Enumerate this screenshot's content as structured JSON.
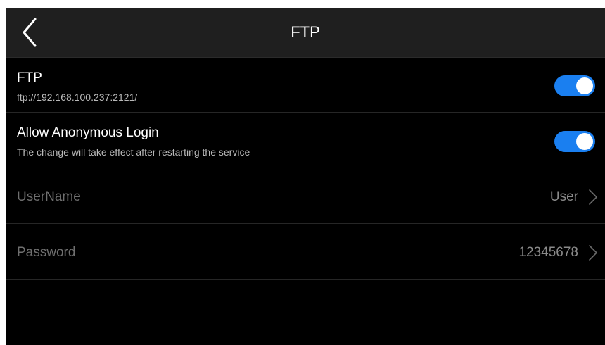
{
  "header": {
    "title": "FTP",
    "back_icon": "chevron-left-icon"
  },
  "ftp": {
    "title": "FTP",
    "address": "ftp://192.168.100.237:2121/",
    "enabled": true
  },
  "anonymous_login": {
    "title": "Allow Anonymous Login",
    "description": "The change will take effect after restarting the service",
    "enabled": true
  },
  "username": {
    "label": "UserName",
    "value": "User",
    "icon": "chevron-right-icon"
  },
  "password": {
    "label": "Password",
    "value": "12345678",
    "icon": "chevron-right-icon"
  },
  "colors": {
    "toggle_on": "#1a7ff0",
    "header_bg": "#1f1f1f",
    "background": "#000000"
  }
}
